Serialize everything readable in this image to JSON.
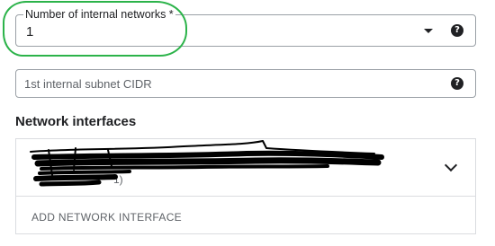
{
  "networks": {
    "label": "Number of internal networks *",
    "value": "1",
    "help_glyph": "?"
  },
  "cidr": {
    "placeholder": "1st internal subnet CIDR",
    "help_glyph": "?"
  },
  "interfaces": {
    "title": "Network interfaces",
    "item_suffix": "1)",
    "add_label": "ADD NETWORK INTERFACE"
  },
  "colors": {
    "highlight": "#2cb34a",
    "redaction": "#000000"
  },
  "icons": {
    "dropdown": "dropdown-arrow-icon",
    "help": "help-circle-icon",
    "expand": "chevron-down-icon"
  }
}
